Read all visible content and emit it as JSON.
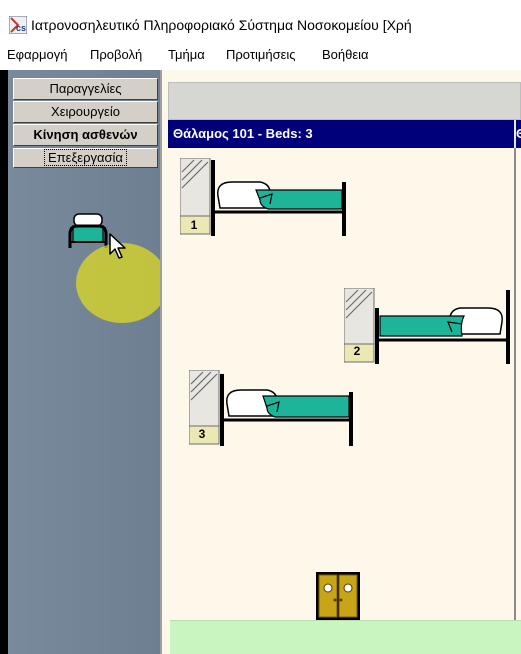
{
  "window": {
    "title": "Ιατρονοσηλευτικό Πληροφοριακό Σύστημα Νοσοκομείου [Χρή"
  },
  "menu": {
    "items": [
      "Εφαρμογή",
      "Προβολή",
      "Τμήμα",
      "Προτιμήσεις",
      "Βοήθεια"
    ]
  },
  "sidebar": {
    "buttons": [
      {
        "label": "Παραγγελίες",
        "bold": false
      },
      {
        "label": "Χειρουργείο",
        "bold": false
      },
      {
        "label": "Κίνηση ασθενών",
        "bold": true
      },
      {
        "label": "Επεξεργασία",
        "bold": false,
        "focused": true
      }
    ]
  },
  "room": {
    "header": "Θάλαμος 101 - Beds: 3",
    "next_header_partial": "Θ",
    "beds": [
      {
        "number": "1",
        "orientation": "left"
      },
      {
        "number": "2",
        "orientation": "right"
      },
      {
        "number": "3",
        "orientation": "left"
      }
    ]
  },
  "colors": {
    "header_bg": "#00007b",
    "room_bg": "#fdf8ea",
    "sheet": "#1eb49a",
    "highlight": "#e2dc1e",
    "footer": "#c8f5c0"
  },
  "icons": {
    "app": "app-logo-icon",
    "bed": "bed-icon",
    "door": "door-icon",
    "cursor": "mouse-cursor-icon"
  }
}
